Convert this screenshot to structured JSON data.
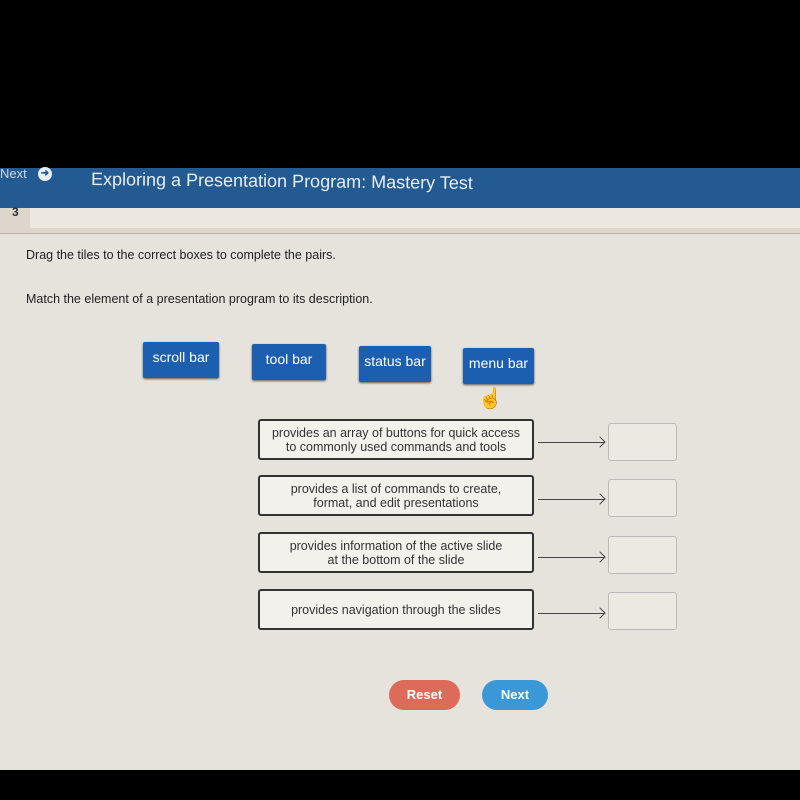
{
  "header": {
    "nav_label": "Next",
    "title": "Exploring a Presentation Program: Mastery Test"
  },
  "question_number": "3",
  "instructions": [
    "Drag the tiles to the correct boxes to complete the pairs.",
    "Match the element of a presentation program to its description."
  ],
  "tiles": [
    "scroll bar",
    "tool bar",
    "status bar",
    "menu bar"
  ],
  "descriptions": [
    {
      "line1": "provides an array of buttons for quick access",
      "line2": "to commonly used commands and tools"
    },
    {
      "line1": "provides a list of commands to create,",
      "line2": "format, and edit presentations"
    },
    {
      "line1": "provides information of the active slide",
      "line2": "at the bottom of the slide"
    },
    {
      "line1": "provides navigation through the slides",
      "line2": ""
    }
  ],
  "buttons": {
    "reset": "Reset",
    "next": "Next"
  },
  "colors": {
    "header": "#245a92",
    "tile": "#1c5fb0",
    "reset": "#de6b5a",
    "next": "#3a97d8"
  }
}
